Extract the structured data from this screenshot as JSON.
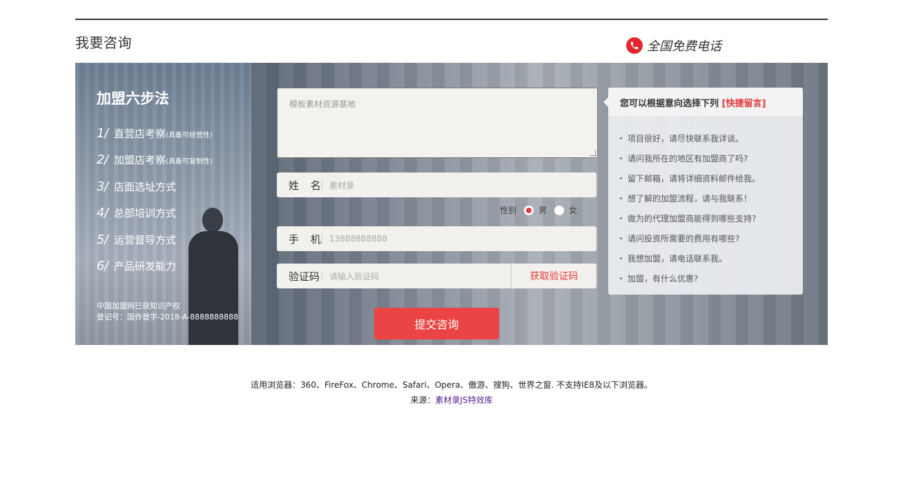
{
  "header": {
    "title": "我要咨询",
    "hotline_label": "全国免费电话",
    "hotline_icon": "phone-icon"
  },
  "steps": {
    "title": "加盟六步法",
    "items": [
      {
        "num": "1",
        "label": "直营店考察",
        "note": "(具备可经营性)"
      },
      {
        "num": "2",
        "label": "加盟店考察",
        "note": "(具备可复制性)"
      },
      {
        "num": "3",
        "label": "店面选址方式",
        "note": ""
      },
      {
        "num": "4",
        "label": "总部培训方式",
        "note": ""
      },
      {
        "num": "5",
        "label": "运营督导方式",
        "note": ""
      },
      {
        "num": "6",
        "label": "产品研发能力",
        "note": ""
      }
    ],
    "copyright_line1": "中国加盟网已获知识产权",
    "copyright_line2": "登记号：国作登字-2018-A-8888888888"
  },
  "form": {
    "message_placeholder": "模板素材资源基地",
    "name_label": "姓 名",
    "name_placeholder": "素材录",
    "gender_label": "性别",
    "gender_options": [
      {
        "label": "男",
        "checked": true
      },
      {
        "label": "女",
        "checked": false
      }
    ],
    "phone_label": "手 机",
    "phone_placeholder": "13888888888",
    "code_label": "验证码",
    "code_placeholder": "请输入验证码",
    "get_code_label": "获取验证码",
    "submit_label": "提交咨询"
  },
  "suggestions": {
    "title": "您可以根据意向选择下列",
    "title_highlight": "[快捷留言]",
    "items": [
      "项目很好，请尽快联系我详谈。",
      "请问我所在的地区有加盟商了吗?",
      "留下邮箱，请将详细资料邮件给我。",
      "想了解的加盟流程，请与我联系！",
      "做为的代理加盟商能得到哪些支持?",
      "请问投资所需要的费用有哪些?",
      "我想加盟，请电话联系我。",
      "加盟，有什么优惠?"
    ]
  },
  "footer": {
    "browsers": "适用浏览器：360、FireFox、Chrome、Safari、Opera、傲游、搜狗、世界之窗. 不支持IE8及以下浏览器。",
    "source_label": "来源：",
    "source_link": "素材录JS特效库"
  },
  "colors": {
    "accent": "#ea4444",
    "highlight": "#e03a3a"
  }
}
